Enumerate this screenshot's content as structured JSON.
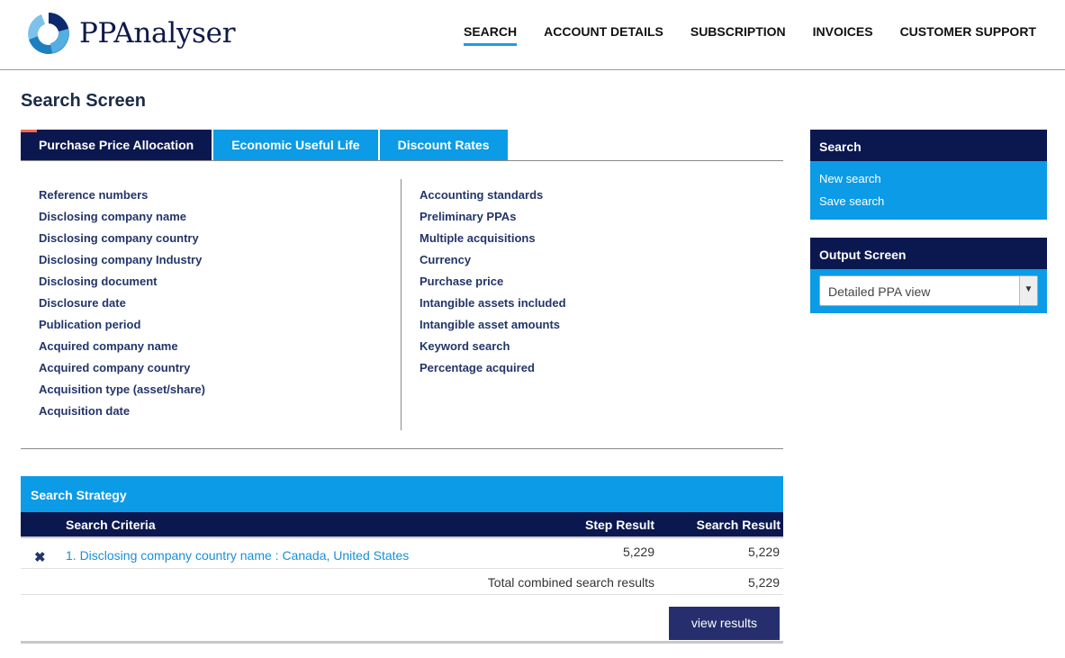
{
  "header": {
    "logo_text": "PPAnalyser",
    "nav": [
      "SEARCH",
      "ACCOUNT DETAILS",
      "SUBSCRIPTION",
      "INVOICES",
      "CUSTOMER SUPPORT"
    ],
    "active_nav": "SEARCH"
  },
  "page_title": "Search Screen",
  "tabs": [
    "Purchase Price Allocation",
    "Economic Useful Life",
    "Discount Rates"
  ],
  "fields_left": [
    "Reference numbers",
    "Disclosing company name",
    "Disclosing company country",
    "Disclosing company Industry",
    "Disclosing document",
    "Disclosure date",
    "Publication period",
    "Acquired company name",
    "Acquired company country",
    "Acquisition type (asset/share)",
    "Acquisition date"
  ],
  "fields_right": [
    "Accounting standards",
    "Preliminary PPAs",
    "Multiple acquisitions",
    "Currency",
    "Purchase price",
    "Intangible assets included",
    "Intangible asset amounts",
    "Keyword search",
    "Percentage acquired"
  ],
  "strategy": {
    "title": "Search Strategy",
    "col_criteria": "Search Criteria",
    "col_step": "Step Result",
    "col_result": "Search Result",
    "row_criteria": "1. Disclosing company country name : Canada, United States",
    "row_step": "5,229",
    "row_result": "5,229",
    "total_label": "Total combined search results",
    "total_result": "5,229",
    "button": "view results"
  },
  "side_search": {
    "title": "Search",
    "links": [
      "New search",
      "Save search"
    ]
  },
  "side_output": {
    "title": "Output Screen",
    "selected": "Detailed PPA view"
  },
  "colors": {
    "navy": "#0b1850",
    "blue": "#0c9be6",
    "accent": "#f06a4a"
  }
}
